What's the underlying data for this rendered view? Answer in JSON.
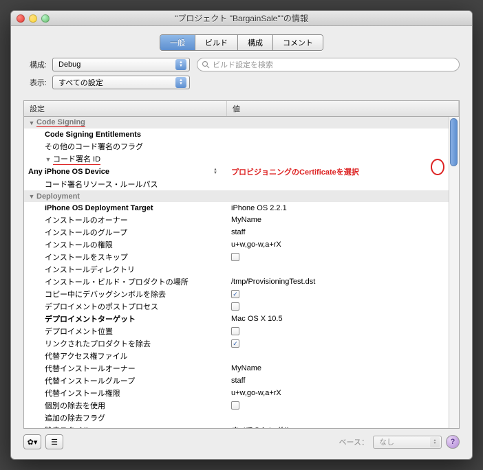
{
  "title": "\"プロジェクト \"BargainSale\"\"の情報",
  "tabs": [
    "一般",
    "ビルド",
    "構成",
    "コメント"
  ],
  "config": {
    "label": "構成:",
    "value": "Debug"
  },
  "display": {
    "label": "表示:",
    "value": "すべての設定"
  },
  "search": {
    "placeholder": "ビルド設定を検索"
  },
  "columns": {
    "c1": "設定",
    "c2": "値"
  },
  "base": {
    "label": "ベース：",
    "value": "なし"
  },
  "groups": [
    {
      "name": "Code Signing",
      "underline": true,
      "rows": [
        {
          "label": "Code Signing Entitlements",
          "bold": true,
          "value": ""
        },
        {
          "label": "その他のコード署名のフラグ",
          "value": ""
        },
        {
          "label": "コード署名 ID",
          "disc": true,
          "underline": true,
          "sub": true,
          "rows": [
            {
              "label": "Any iPhone OS Device",
              "bold": true,
              "value": "プロビジョニングのCertificateを選択",
              "red": true,
              "spin": true,
              "indent": "2b"
            }
          ]
        },
        {
          "label": "コード署名リソース・ルールパス",
          "value": ""
        }
      ]
    },
    {
      "name": "Deployment",
      "rows": [
        {
          "label": "iPhone OS Deployment Target",
          "bold": true,
          "value": "iPhone OS 2.2.1"
        },
        {
          "label": "インストールのオーナー",
          "value": "MyName"
        },
        {
          "label": "インストールのグループ",
          "value": "staff"
        },
        {
          "label": "インストールの権限",
          "value": "u+w,go-w,a+rX"
        },
        {
          "label": "インストールをスキップ",
          "check": false
        },
        {
          "label": "インストールディレクトリ",
          "value": ""
        },
        {
          "label": "インストール・ビルド・プロダクトの場所",
          "value": "/tmp/ProvisioningTest.dst"
        },
        {
          "label": "コピー中にデバッグシンボルを除去",
          "check": true
        },
        {
          "label": "デプロイメントのポストプロセス",
          "check": false
        },
        {
          "label": "デプロイメントターゲット",
          "bold": true,
          "value": "Mac OS X 10.5"
        },
        {
          "label": "デプロイメント位置",
          "check": false
        },
        {
          "label": "リンクされたプロダクトを除去",
          "check": true
        },
        {
          "label": "代替アクセス権ファイル",
          "value": ""
        },
        {
          "label": "代替インストールオーナー",
          "value": "MyName"
        },
        {
          "label": "代替インストールグループ",
          "value": "staff"
        },
        {
          "label": "代替インストール権限",
          "value": "u+w,go-w,a+rX"
        },
        {
          "label": "個別の除去を使用",
          "check": false
        },
        {
          "label": "追加の除去フラグ",
          "value": ""
        },
        {
          "label": "除去スタイル",
          "value": "すべてのシンボル"
        }
      ]
    }
  ]
}
